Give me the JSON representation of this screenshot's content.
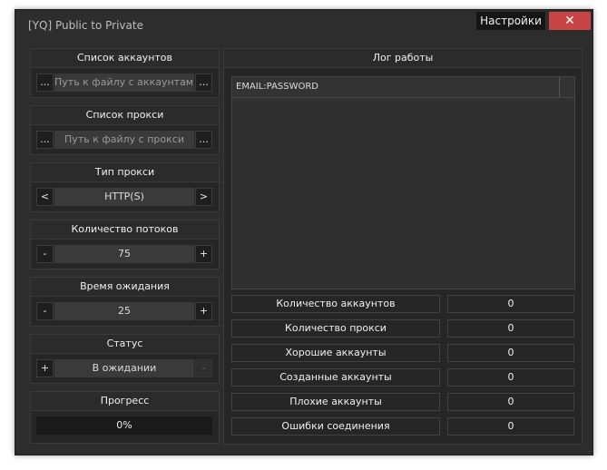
{
  "window": {
    "title": "[YQ] Public to Private",
    "settings_label": "Настройки",
    "close_glyph": "✕"
  },
  "accounts": {
    "header": "Список аккаунтов",
    "placeholder": "Путь к файлу с аккаунтами",
    "browse_left": "...",
    "browse_right": "..."
  },
  "proxies": {
    "header": "Список прокси",
    "placeholder": "Путь к файлу с прокси",
    "browse_left": "...",
    "browse_right": "..."
  },
  "proxy_type": {
    "header": "Тип прокси",
    "value": "HTTP(S)",
    "prev": "<",
    "next": ">"
  },
  "threads": {
    "header": "Количество потоков",
    "value": "75",
    "minus": "-",
    "plus": "+"
  },
  "timeout": {
    "header": "Время ожидания",
    "value": "25",
    "minus": "-",
    "plus": "+"
  },
  "status": {
    "header": "Статус",
    "value": "В ожидании",
    "plus": "+",
    "minus": "-"
  },
  "progress": {
    "header": "Прогресс",
    "value": "0%"
  },
  "log": {
    "header": "Лог работы",
    "column": "EMAIL:PASSWORD"
  },
  "stats": [
    {
      "label": "Количество аккаунтов",
      "value": "0"
    },
    {
      "label": "Количество прокси",
      "value": "0"
    },
    {
      "label": "Хорошие аккаунты",
      "value": "0"
    },
    {
      "label": "Созданные аккаунты",
      "value": "0"
    },
    {
      "label": "Плохие аккаунты",
      "value": "0"
    },
    {
      "label": "Ошибки соединения",
      "value": "0"
    }
  ]
}
